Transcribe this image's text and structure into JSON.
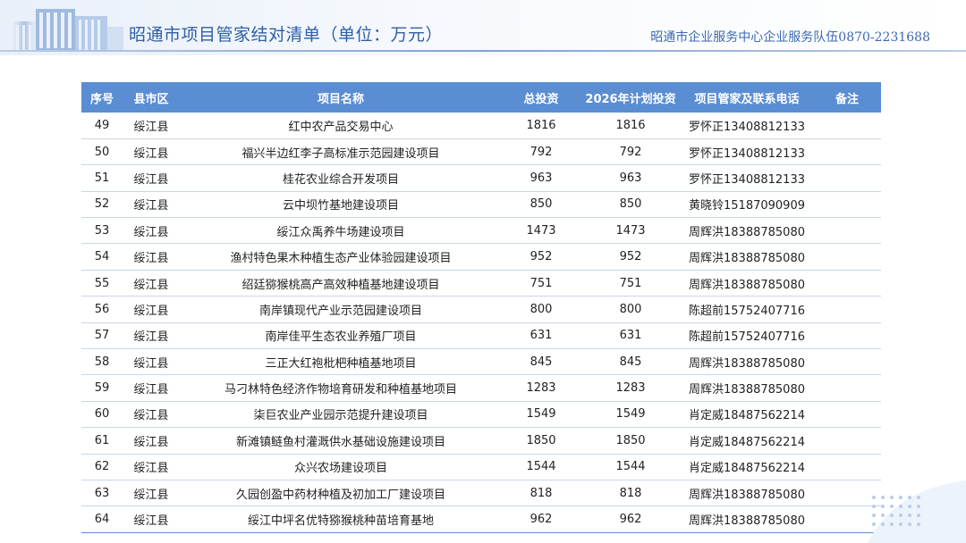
{
  "header": {
    "title": "昭通市项目管家结对清单（单位：万元）",
    "contact": "昭通市企业服务中心企业服务队伍0870-2231688"
  },
  "table": {
    "columns": [
      "序号",
      "县市区",
      "项目名称",
      "总投资",
      "2026年计划投资",
      "项目管家及联系电话",
      "备注"
    ],
    "rows": [
      {
        "no": "49",
        "county": "绥江县",
        "name": "红中农产品交易中心",
        "total": "1816",
        "plan": "1816",
        "manager": "罗怀正13408812133",
        "note": ""
      },
      {
        "no": "50",
        "county": "绥江县",
        "name": "福兴半边红李子高标准示范园建设项目",
        "total": "792",
        "plan": "792",
        "manager": "罗怀正13408812133",
        "note": ""
      },
      {
        "no": "51",
        "county": "绥江县",
        "name": "桂花农业综合开发项目",
        "total": "963",
        "plan": "963",
        "manager": "罗怀正13408812133",
        "note": ""
      },
      {
        "no": "52",
        "county": "绥江县",
        "name": "云中坝竹基地建设项目",
        "total": "850",
        "plan": "850",
        "manager": "黄晓铃15187090909",
        "note": ""
      },
      {
        "no": "53",
        "county": "绥江县",
        "name": "绥江众禹养牛场建设项目",
        "total": "1473",
        "plan": "1473",
        "manager": "周辉洪18388785080",
        "note": ""
      },
      {
        "no": "54",
        "county": "绥江县",
        "name": "渔村特色果木种植生态产业体验园建设项目",
        "total": "952",
        "plan": "952",
        "manager": "周辉洪18388785080",
        "note": ""
      },
      {
        "no": "55",
        "county": "绥江县",
        "name": "绍廷猕猴桃高产高效种植基地建设项目",
        "total": "751",
        "plan": "751",
        "manager": "周辉洪18388785080",
        "note": ""
      },
      {
        "no": "56",
        "county": "绥江县",
        "name": "南岸镇现代产业示范园建设项目",
        "total": "800",
        "plan": "800",
        "manager": "陈超前15752407716",
        "note": ""
      },
      {
        "no": "57",
        "county": "绥江县",
        "name": "南岸佳平生态农业养殖厂项目",
        "total": "631",
        "plan": "631",
        "manager": "陈超前15752407716",
        "note": ""
      },
      {
        "no": "58",
        "county": "绥江县",
        "name": "三正大红袍枇杷种植基地项目",
        "total": "845",
        "plan": "845",
        "manager": "周辉洪18388785080",
        "note": ""
      },
      {
        "no": "59",
        "county": "绥江县",
        "name": "马刁林特色经济作物培育研发和种植基地项目",
        "total": "1283",
        "plan": "1283",
        "manager": "周辉洪18388785080",
        "note": ""
      },
      {
        "no": "60",
        "county": "绥江县",
        "name": "柒巨农业产业园示范提升建设项目",
        "total": "1549",
        "plan": "1549",
        "manager": "肖定威18487562214",
        "note": ""
      },
      {
        "no": "61",
        "county": "绥江县",
        "name": "新滩镇鲢鱼村灌溉供水基础设施建设项目",
        "total": "1850",
        "plan": "1850",
        "manager": "肖定威18487562214",
        "note": ""
      },
      {
        "no": "62",
        "county": "绥江县",
        "name": "众兴农场建设项目",
        "total": "1544",
        "plan": "1544",
        "manager": "肖定威18487562214",
        "note": ""
      },
      {
        "no": "63",
        "county": "绥江县",
        "name": "久园创盈中药材种植及初加工厂建设项目",
        "total": "818",
        "plan": "818",
        "manager": "周辉洪18388785080",
        "note": ""
      },
      {
        "no": "64",
        "county": "绥江县",
        "name": "绥江中坪名优特猕猴桃种苗培育基地",
        "total": "962",
        "plan": "962",
        "manager": "周辉洪18388785080",
        "note": ""
      }
    ]
  },
  "colors": {
    "accent": "#5b8dd3",
    "title": "#2f5fa6",
    "row_border": "#c9d6ea"
  }
}
